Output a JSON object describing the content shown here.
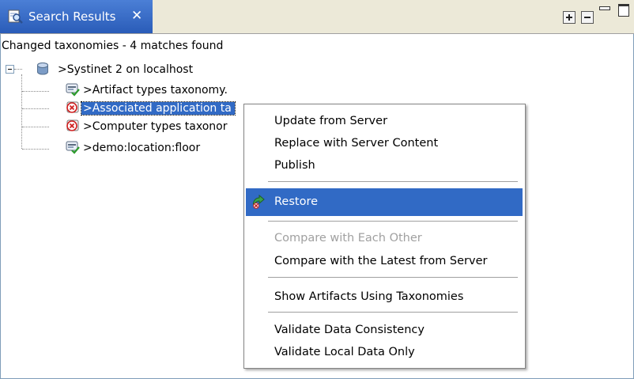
{
  "view": {
    "tab_title": "Search Results",
    "close_glyph": "✕",
    "status": "Changed taxonomies - 4 matches found"
  },
  "tree": {
    "root": {
      "label": ">Systinet 2 on localhost",
      "icon": "server-icon",
      "expanded": true
    },
    "children": [
      {
        "label": ">Artifact types taxonomy.",
        "icon": "taxonomy-ok-icon",
        "selected": false
      },
      {
        "label": ">Associated application ta",
        "icon": "taxonomy-error-icon",
        "selected": true
      },
      {
        "label": ">Computer types taxonor",
        "icon": "taxonomy-error-icon",
        "selected": false
      },
      {
        "label": ">demo:location:floor",
        "icon": "taxonomy-ok-icon",
        "selected": false
      }
    ]
  },
  "context_menu": {
    "groups": [
      [
        {
          "label": "Update from Server",
          "enabled": true
        },
        {
          "label": "Replace with Server Content",
          "enabled": true
        },
        {
          "label": "Publish",
          "enabled": true
        }
      ],
      [
        {
          "label": "Restore",
          "enabled": true,
          "highlighted": true,
          "icon": "restore-icon"
        }
      ],
      [
        {
          "label": "Compare with Each Other",
          "enabled": false
        },
        {
          "label": "Compare with the Latest from Server",
          "enabled": true
        }
      ],
      [
        {
          "label": "Show Artifacts Using Taxonomies",
          "enabled": true
        }
      ],
      [
        {
          "label": "Validate Data Consistency",
          "enabled": true
        },
        {
          "label": "Validate Local Data Only",
          "enabled": true
        }
      ]
    ]
  },
  "colors": {
    "selection": "#316ac5",
    "tab_blue": "#2a5cb8",
    "disabled_text": "#a0a0a0"
  }
}
